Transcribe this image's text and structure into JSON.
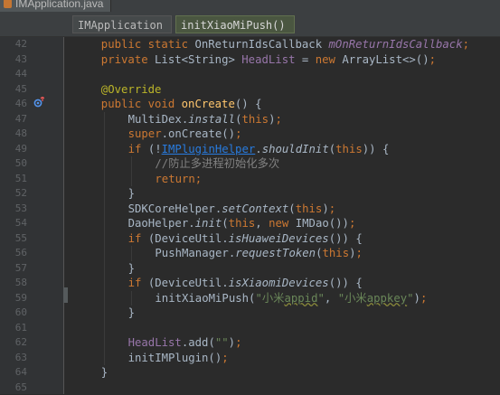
{
  "file_tab": {
    "title": "IMApplication.java"
  },
  "breadcrumbs": [
    "IMApplication",
    "initXiaoMiPush()"
  ],
  "colors": {
    "keyword": "#cc7832",
    "function": "#ffc66d",
    "field": "#9876aa",
    "string": "#6a8759",
    "comment": "#808080",
    "annotation": "#bbb529",
    "link": "#287bde",
    "text": "#a9b7c6"
  },
  "gutter_icons": [
    {
      "line": "46",
      "icon": "override-method-icon"
    }
  ],
  "code_lines": [
    {
      "no": "42",
      "indent": 4,
      "tokens": [
        {
          "t": "public static ",
          "c": "kw"
        },
        {
          "t": "OnReturnIdsCallback "
        },
        {
          "t": "mOnReturnIdsCallback",
          "c": "field",
          "i": true
        },
        {
          "t": ";",
          "c": "kw"
        }
      ]
    },
    {
      "no": "43",
      "indent": 4,
      "tokens": [
        {
          "t": "private ",
          "c": "kw"
        },
        {
          "t": "List<String> "
        },
        {
          "t": "HeadList",
          "c": "field"
        },
        {
          "t": " = "
        },
        {
          "t": "new ",
          "c": "kw"
        },
        {
          "t": "ArrayList<>()"
        },
        {
          "t": ";",
          "c": "kw"
        }
      ]
    },
    {
      "no": "44",
      "indent": 0,
      "tokens": []
    },
    {
      "no": "45",
      "indent": 4,
      "tokens": [
        {
          "t": "@Override",
          "c": "annotation"
        }
      ]
    },
    {
      "no": "46",
      "indent": 4,
      "tokens": [
        {
          "t": "public void ",
          "c": "kw"
        },
        {
          "t": "onCreate",
          "c": "fn"
        },
        {
          "t": "() {"
        }
      ]
    },
    {
      "no": "47",
      "indent": 8,
      "tokens": [
        {
          "t": "MultiDex."
        },
        {
          "t": "install",
          "i": true
        },
        {
          "t": "("
        },
        {
          "t": "this",
          "c": "kw"
        },
        {
          "t": ")"
        },
        {
          "t": ";",
          "c": "kw"
        }
      ]
    },
    {
      "no": "48",
      "indent": 8,
      "tokens": [
        {
          "t": "super",
          "c": "kw"
        },
        {
          "t": ".onCreate()"
        },
        {
          "t": ";",
          "c": "kw"
        }
      ]
    },
    {
      "no": "49",
      "indent": 8,
      "tokens": [
        {
          "t": "if ",
          "c": "kw"
        },
        {
          "t": "(!"
        },
        {
          "t": "IMPluginHelper",
          "c": "link",
          "u": true
        },
        {
          "t": "."
        },
        {
          "t": "shouldInit",
          "i": true
        },
        {
          "t": "("
        },
        {
          "t": "this",
          "c": "kw"
        },
        {
          "t": ")) {"
        }
      ]
    },
    {
      "no": "50",
      "indent": 12,
      "tokens": [
        {
          "t": "//防止多进程初始化多次",
          "c": "comment"
        }
      ]
    },
    {
      "no": "51",
      "indent": 12,
      "tokens": [
        {
          "t": "return;",
          "c": "kw"
        }
      ]
    },
    {
      "no": "52",
      "indent": 8,
      "tokens": [
        {
          "t": "}"
        }
      ]
    },
    {
      "no": "53",
      "indent": 8,
      "tokens": [
        {
          "t": "SDKCoreHelper."
        },
        {
          "t": "setContext",
          "i": true
        },
        {
          "t": "("
        },
        {
          "t": "this",
          "c": "kw"
        },
        {
          "t": ")"
        },
        {
          "t": ";",
          "c": "kw"
        }
      ]
    },
    {
      "no": "54",
      "indent": 8,
      "tokens": [
        {
          "t": "DaoHelper."
        },
        {
          "t": "init",
          "i": true
        },
        {
          "t": "("
        },
        {
          "t": "this",
          "c": "kw"
        },
        {
          "t": ", "
        },
        {
          "t": "new ",
          "c": "kw"
        },
        {
          "t": "IMDao())"
        },
        {
          "t": ";",
          "c": "kw"
        }
      ]
    },
    {
      "no": "55",
      "indent": 8,
      "tokens": [
        {
          "t": "if ",
          "c": "kw"
        },
        {
          "t": "(DeviceUtil."
        },
        {
          "t": "isHuaweiDevices",
          "i": true
        },
        {
          "t": "()) {"
        }
      ]
    },
    {
      "no": "56",
      "indent": 12,
      "tokens": [
        {
          "t": "PushManager."
        },
        {
          "t": "requestToken",
          "i": true
        },
        {
          "t": "("
        },
        {
          "t": "this",
          "c": "kw"
        },
        {
          "t": ")"
        },
        {
          "t": ";",
          "c": "kw"
        }
      ]
    },
    {
      "no": "57",
      "indent": 8,
      "tokens": [
        {
          "t": "}"
        }
      ]
    },
    {
      "no": "58",
      "indent": 8,
      "tokens": [
        {
          "t": "if ",
          "c": "kw"
        },
        {
          "t": "(DeviceUtil."
        },
        {
          "t": "isXiaomiDevices",
          "i": true
        },
        {
          "t": "()) {"
        }
      ]
    },
    {
      "no": "59",
      "indent": 12,
      "tokens": [
        {
          "t": "initXiaoMiPush("
        },
        {
          "t": "\"小米",
          "c": "string"
        },
        {
          "t": "appid",
          "c": "string",
          "w": true
        },
        {
          "t": "\"",
          "c": "string"
        },
        {
          "t": ", "
        },
        {
          "t": "\"小米",
          "c": "string"
        },
        {
          "t": "appkey",
          "c": "string",
          "w": true
        },
        {
          "t": "\"",
          "c": "string"
        },
        {
          "t": ")"
        },
        {
          "t": ";",
          "c": "kw"
        }
      ]
    },
    {
      "no": "60",
      "indent": 8,
      "tokens": [
        {
          "t": "}"
        }
      ]
    },
    {
      "no": "61",
      "indent": 0,
      "tokens": []
    },
    {
      "no": "62",
      "indent": 8,
      "tokens": [
        {
          "t": "HeadList",
          "c": "field"
        },
        {
          "t": ".add("
        },
        {
          "t": "\"\"",
          "c": "string"
        },
        {
          "t": ")"
        },
        {
          "t": ";",
          "c": "kw"
        }
      ]
    },
    {
      "no": "63",
      "indent": 8,
      "tokens": [
        {
          "t": "initIMPlugin()"
        },
        {
          "t": ";",
          "c": "kw"
        }
      ]
    },
    {
      "no": "64",
      "indent": 4,
      "tokens": [
        {
          "t": "}"
        }
      ]
    },
    {
      "no": "65",
      "indent": 0,
      "tokens": []
    }
  ]
}
